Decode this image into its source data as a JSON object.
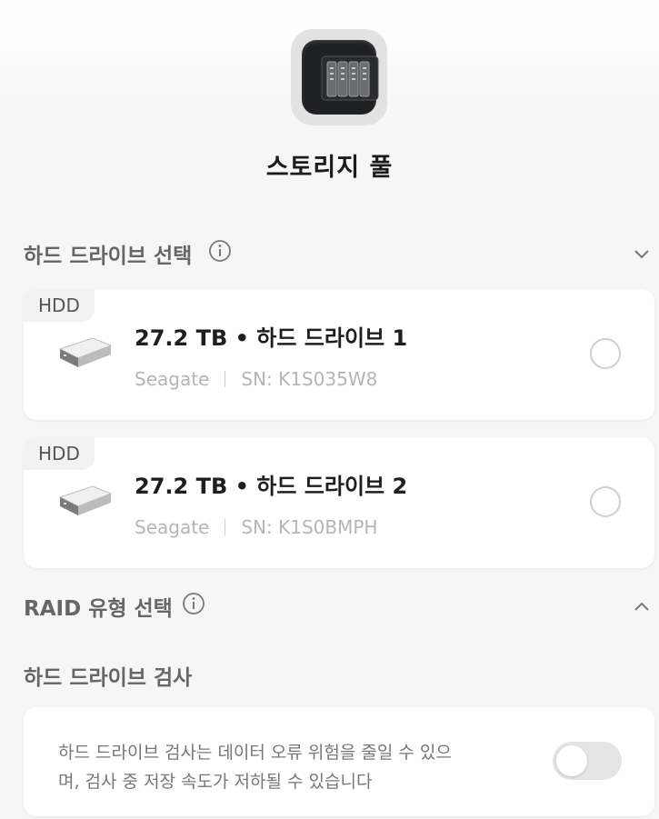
{
  "header": {
    "title": "스토리지 풀",
    "app_icon": "storage-pool-icon"
  },
  "drive_section": {
    "label": "하드 드라이브 선택"
  },
  "drives": [
    {
      "tag": "HDD",
      "name": "27.2 TB • 하드 드라이브 1",
      "vendor": "Seagate",
      "serial": "SN: K1S035W8",
      "selected": false
    },
    {
      "tag": "HDD",
      "name": "27.2 TB • 하드 드라이브 2",
      "vendor": "Seagate",
      "serial": "SN: K1S0BMPH",
      "selected": false
    }
  ],
  "raid_section": {
    "label": "RAID 유형 선택"
  },
  "check_section": {
    "label": "하드 드라이브 검사",
    "description_line1": "하드 드라이브 검사는 데이터 오류 위험을 줄일 수 있으",
    "description_line2": "며, 검사 중 저장 속도가 저하될 수 있습니다",
    "enabled": false
  }
}
